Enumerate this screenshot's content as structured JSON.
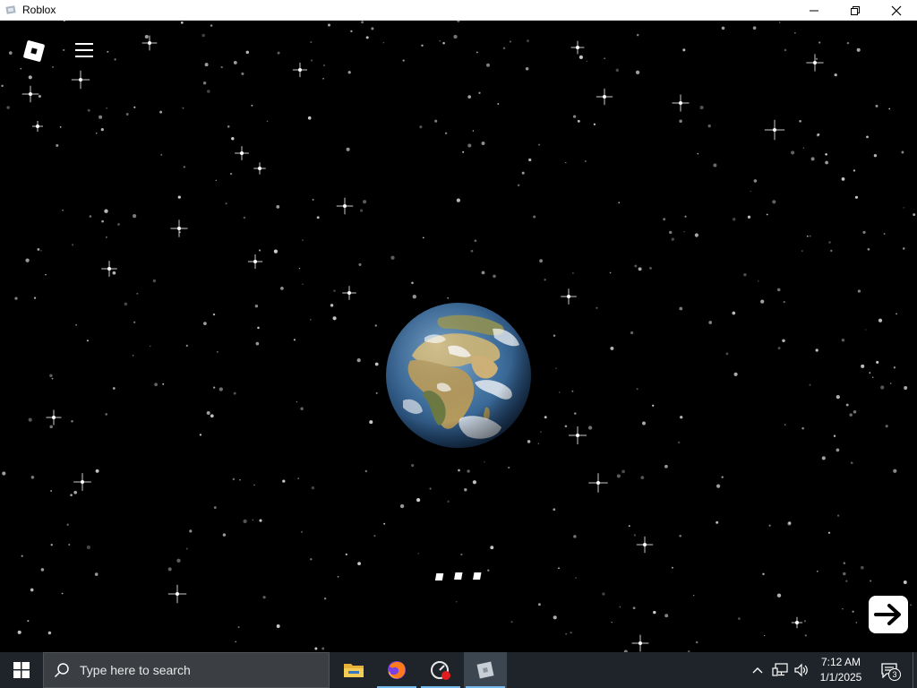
{
  "window": {
    "title": "Roblox",
    "icon": "roblox-app-icon",
    "controls": [
      "minimize-icon",
      "restore-icon",
      "close-icon"
    ]
  },
  "game": {
    "background": "starfield",
    "top_left": {
      "logo_icon": "roblox-logo-icon",
      "menu_icon": "hamburger-menu-icon"
    },
    "center_image": "earth-globe",
    "loading_indicator": "three-dots",
    "next_button_icon": "arrow-right-icon"
  },
  "taskbar": {
    "start_icon": "windows-logo-icon",
    "search": {
      "placeholder": "Type here to search",
      "icon": "search-icon"
    },
    "pinned_apps": [
      {
        "name": "file-explorer",
        "icon": "folder-icon",
        "running": false
      },
      {
        "name": "firefox",
        "icon": "firefox-icon",
        "running": true
      },
      {
        "name": "speedometer-app",
        "icon": "gauge-icon",
        "running": true
      },
      {
        "name": "roblox",
        "icon": "roblox-app-icon",
        "running": true,
        "active": true
      }
    ],
    "tray": {
      "icons": [
        "chevron-up-icon",
        "network-icon",
        "volume-icon"
      ],
      "time": "7:12 AM",
      "date": "1/1/2025",
      "notification_count": "3"
    }
  },
  "colors": {
    "taskbar_bg": "#1e2429",
    "running_indicator": "#76b9ed",
    "game_bg": "#000000"
  }
}
